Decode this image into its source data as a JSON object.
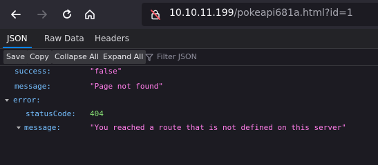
{
  "browser": {
    "url_host": "10.10.11.199",
    "url_path": "/pokeapi681a.html?id=1"
  },
  "viewer_tabs": {
    "json": "JSON",
    "raw_data": "Raw Data",
    "headers": "Headers"
  },
  "actions": {
    "save": "Save",
    "copy": "Copy",
    "collapse_all": "Collapse All",
    "expand_all": "Expand All",
    "filter_placeholder": "Filter JSON"
  },
  "json_rows": {
    "success_key": "success:",
    "success_val": "\"false\"",
    "message_key": "message:",
    "message_val": "\"Page not found\"",
    "error_key": "error:",
    "status_key": "statusCode:",
    "status_val": "404",
    "error_message_key": "message:",
    "error_message_val": "\"You reached a route that is not defined on this server\""
  },
  "colors": {
    "key": "#75bfff",
    "string": "#ff7de9",
    "number": "#86de74",
    "active_tab_underline": "#0a84ff"
  }
}
